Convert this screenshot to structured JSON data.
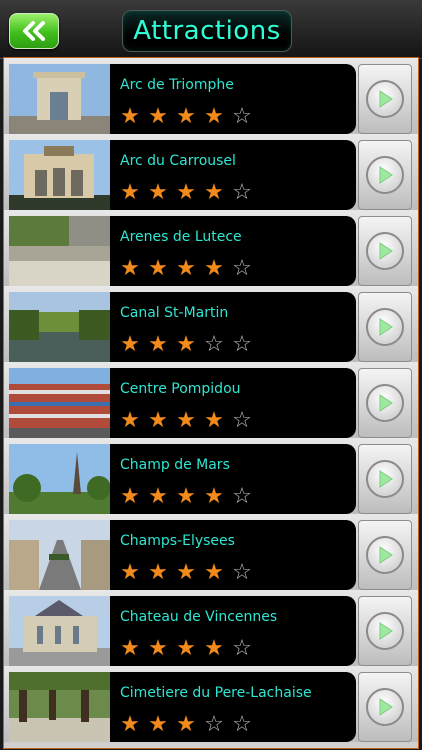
{
  "header": {
    "title": "Attractions",
    "back_icon": "double-chevron-left-icon"
  },
  "colors": {
    "accent": "#2fffd6",
    "star_on": "#f28a1c",
    "star_off": "#bdbdbd",
    "back_button": "#3fbf1c"
  },
  "attractions": [
    {
      "name": "Arc de Triomphe",
      "rating": 4
    },
    {
      "name": "Arc du Carrousel",
      "rating": 4
    },
    {
      "name": "Arenes de Lutece",
      "rating": 4
    },
    {
      "name": "Canal St-Martin",
      "rating": 3
    },
    {
      "name": "Centre Pompidou",
      "rating": 4
    },
    {
      "name": "Champ de Mars",
      "rating": 4
    },
    {
      "name": "Champs-Elysees",
      "rating": 4
    },
    {
      "name": "Chateau de Vincennes",
      "rating": 4
    },
    {
      "name": "Cimetiere du Pere-Lachaise",
      "rating": 3
    }
  ],
  "max_rating": 5,
  "row_icon": "play-arrow-icon"
}
